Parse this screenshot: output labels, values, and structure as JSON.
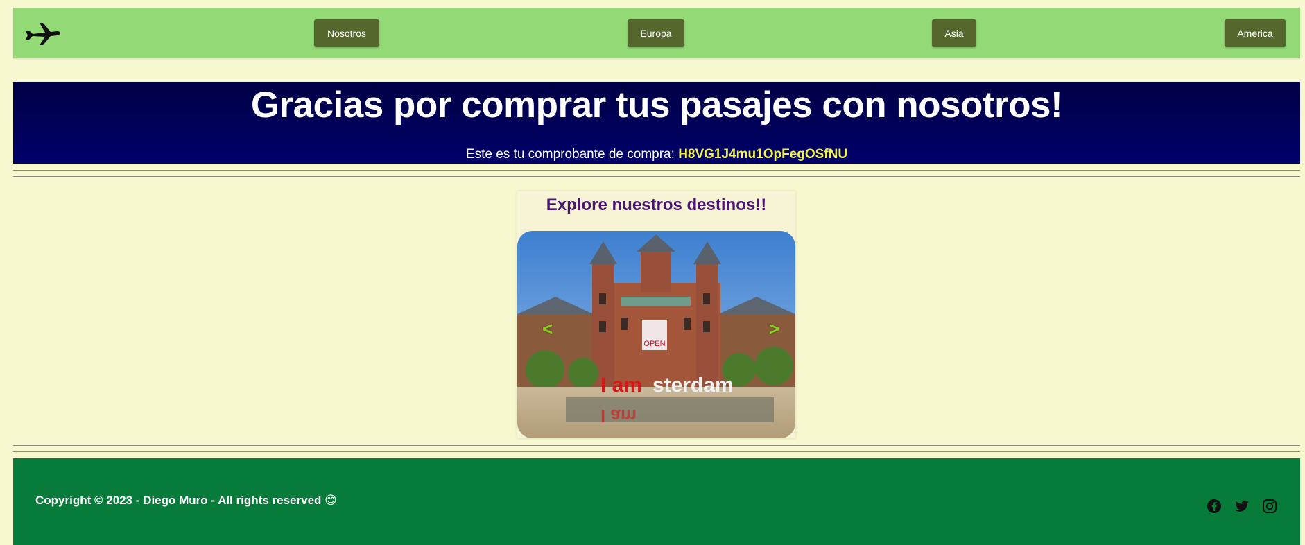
{
  "nav": {
    "logo_icon": "airplane-icon",
    "items": [
      {
        "label": "Nosotros"
      },
      {
        "label": "Europa"
      },
      {
        "label": "Asia"
      },
      {
        "label": "America"
      }
    ],
    "bar_color": "#93da77",
    "button_color": "#55672c"
  },
  "hero": {
    "title": "Gracias por comprar tus pasajes con nosotros!",
    "receipt_label": "Este es tu comprobante de compra:",
    "receipt_code": "H8VG1J4mu1OpFegOSfNU",
    "background": "#000058",
    "code_color": "#f4f44a"
  },
  "carousel": {
    "title": "Explore nuestros destinos!!",
    "prev_icon": "chevron-left-icon",
    "next_icon": "chevron-right-icon",
    "prev_symbol": "<",
    "next_symbol": ">",
    "slide_banner": "OPEN",
    "slide_sign": "I amsterdam",
    "title_color": "#4b1673"
  },
  "footer": {
    "copyright": "Copyright © 2023 - Diego Muro - All rights reserved 😊",
    "social_icons": [
      "facebook-icon",
      "twitter-icon",
      "instagram-icon"
    ],
    "background": "#077b3a"
  }
}
